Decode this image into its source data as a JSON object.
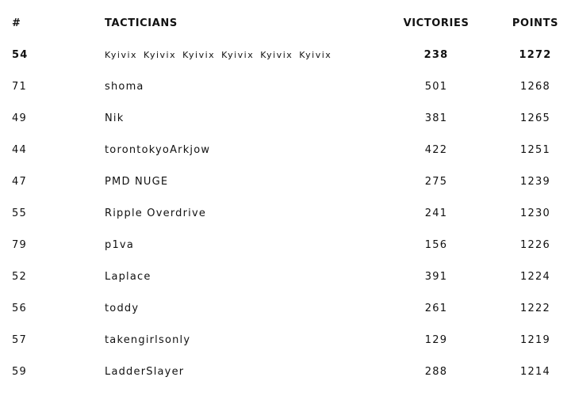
{
  "header": {
    "rank": "#",
    "name": "TACTICIANS",
    "victories": "VICTORIES",
    "points": "POINTS"
  },
  "rows": [
    {
      "rank": "54",
      "name": "Kyivix Kyivix Kyivix   Kyivix Kyivix Kyivix",
      "victories": "238",
      "points": "1272"
    },
    {
      "rank": "71",
      "name": "shoma",
      "victories": "501",
      "points": "1268"
    },
    {
      "rank": "49",
      "name": "Nik",
      "victories": "381",
      "points": "1265"
    },
    {
      "rank": "44",
      "name": "torontokyoArkjow",
      "victories": "422",
      "points": "1251"
    },
    {
      "rank": "47",
      "name": "PMD NUGE",
      "victories": "275",
      "points": "1239"
    },
    {
      "rank": "55",
      "name": "Ripple Overdrive",
      "victories": "241",
      "points": "1230"
    },
    {
      "rank": "79",
      "name": "p1va",
      "victories": "156",
      "points": "1226"
    },
    {
      "rank": "52",
      "name": "Laplace",
      "victories": "391",
      "points": "1224"
    },
    {
      "rank": "56",
      "name": "toddy",
      "victories": "261",
      "points": "1222"
    },
    {
      "rank": "57",
      "name": "takengirlsonly",
      "victories": "129",
      "points": "1219"
    },
    {
      "rank": "59",
      "name": "LadderSlayer",
      "victories": "288",
      "points": "1214"
    }
  ]
}
